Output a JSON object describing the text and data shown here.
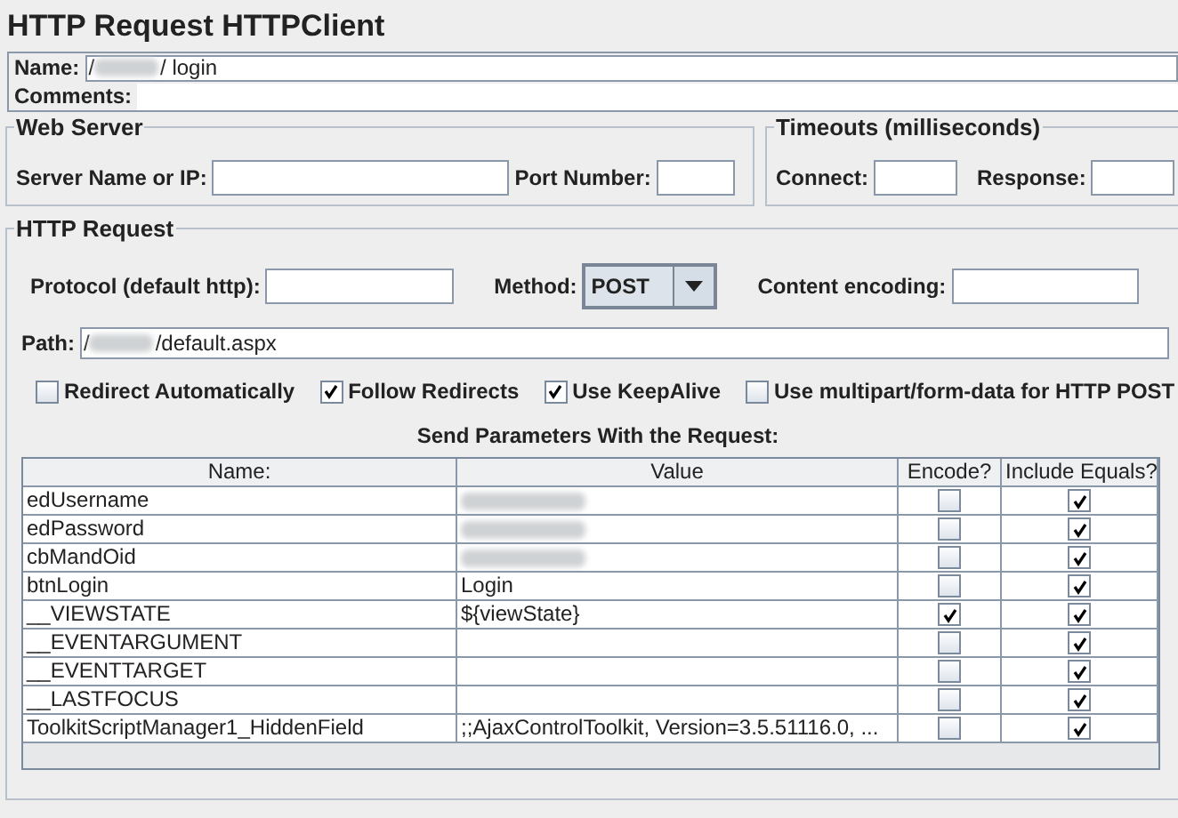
{
  "title": "HTTP Request HTTPClient",
  "name_field": {
    "label": "Name:",
    "prefix": "/",
    "redacted": true,
    "suffix": "/ login"
  },
  "comments_field": {
    "label": "Comments:"
  },
  "web_server": {
    "legend": "Web Server",
    "fields": [
      {
        "label": "Server Name or IP:"
      },
      {
        "label": "Port Number:"
      }
    ]
  },
  "timeouts": {
    "legend": "Timeouts (milliseconds)",
    "fields": [
      {
        "label": "Connect:"
      },
      {
        "label": "Response:"
      }
    ]
  },
  "http_request": {
    "legend": "HTTP Request",
    "protocol": {
      "label": "Protocol (default http):"
    },
    "method": {
      "label": "Method:",
      "value": "POST"
    },
    "content_encoding": {
      "label": "Content encoding:"
    },
    "path": {
      "label": "Path:",
      "prefix": "/",
      "redacted": true,
      "suffix": "/default.aspx"
    },
    "options": [
      {
        "label": "Redirect Automatically",
        "checked": false
      },
      {
        "label": "Follow Redirects",
        "checked": true
      },
      {
        "label": "Use KeepAlive",
        "checked": true
      },
      {
        "label": "Use multipart/form-data for HTTP POST",
        "checked": false
      }
    ],
    "parameters_title": "Send Parameters With the Request:",
    "table": {
      "columns": [
        "Name:",
        "Value",
        "Encode?",
        "Include Equals?"
      ],
      "rows": [
        {
          "name": "edUsername",
          "redacted": true,
          "encode": false,
          "include_equals": true
        },
        {
          "name": "edPassword",
          "redacted": true,
          "encode": false,
          "include_equals": true
        },
        {
          "name": "cbMandOid",
          "redacted": true,
          "encode": false,
          "include_equals": true
        },
        {
          "name": "btnLogin",
          "value": " Login",
          "encode": false,
          "include_equals": true
        },
        {
          "name": "__VIEWSTATE",
          "value": "${viewState}",
          "encode": true,
          "include_equals": true
        },
        {
          "name": "__EVENTARGUMENT",
          "encode": false,
          "include_equals": true
        },
        {
          "name": "__EVENTTARGET",
          "encode": false,
          "include_equals": true
        },
        {
          "name": "__LASTFOCUS",
          "encode": false,
          "include_equals": true
        },
        {
          "name": "ToolkitScriptManager1_HiddenField",
          "value": ";;AjaxControlToolkit, Version=3.5.51116.0, ...",
          "encode": false,
          "include_equals": true
        }
      ]
    }
  }
}
